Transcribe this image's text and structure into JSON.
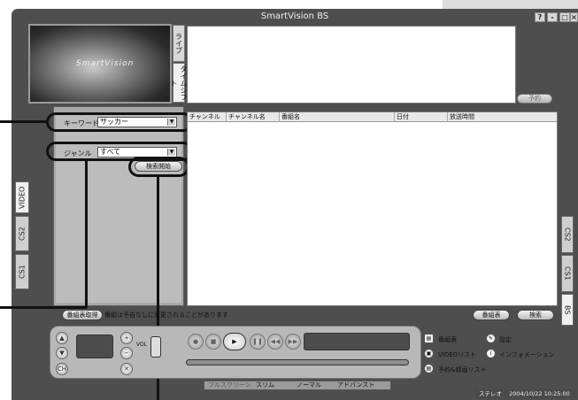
{
  "window": {
    "title": "SmartVision BS",
    "help_label": "?",
    "minimize_label": "-",
    "maximize_label": "□",
    "close_label": "×"
  },
  "preview": {
    "logo_text": "SmartVision"
  },
  "preview_tabs": [
    "ライブ",
    "タイムシフト"
  ],
  "search": {
    "keyword_label": "キーワード",
    "keyword_value": "サッカー",
    "genre_label": "ジャンル",
    "genre_value": "すべて",
    "start_button": "検索開始"
  },
  "source_tabs": [
    "VIDEO",
    "CS2",
    "CS1"
  ],
  "right_tabs": [
    "CS2",
    "CS1",
    "BS"
  ],
  "reserve_button": "予約",
  "list": {
    "columns": [
      "チャンネル",
      "チャンネル名",
      "番組名",
      "日付",
      "放送時間"
    ]
  },
  "status": {
    "left_button": "番組表取得",
    "message": "番組は予告なしに変更されることがあります",
    "guide_button": "番組表",
    "search_button": "検索"
  },
  "menu": {
    "program_guide": "番組表",
    "settings": "設定",
    "video_list": "VIDEOリスト",
    "information": "インフォメーション",
    "reservation_list": "予約&録画リスト"
  },
  "controls": {
    "vol_label": "VOL",
    "ch_label": "CH"
  },
  "modes": [
    "フルスクリーン",
    "スリム",
    "ノーマル",
    "アドバンスト"
  ],
  "footer": {
    "audio": "ステレオ",
    "datetime": "2004/10/22 10:25:00"
  }
}
